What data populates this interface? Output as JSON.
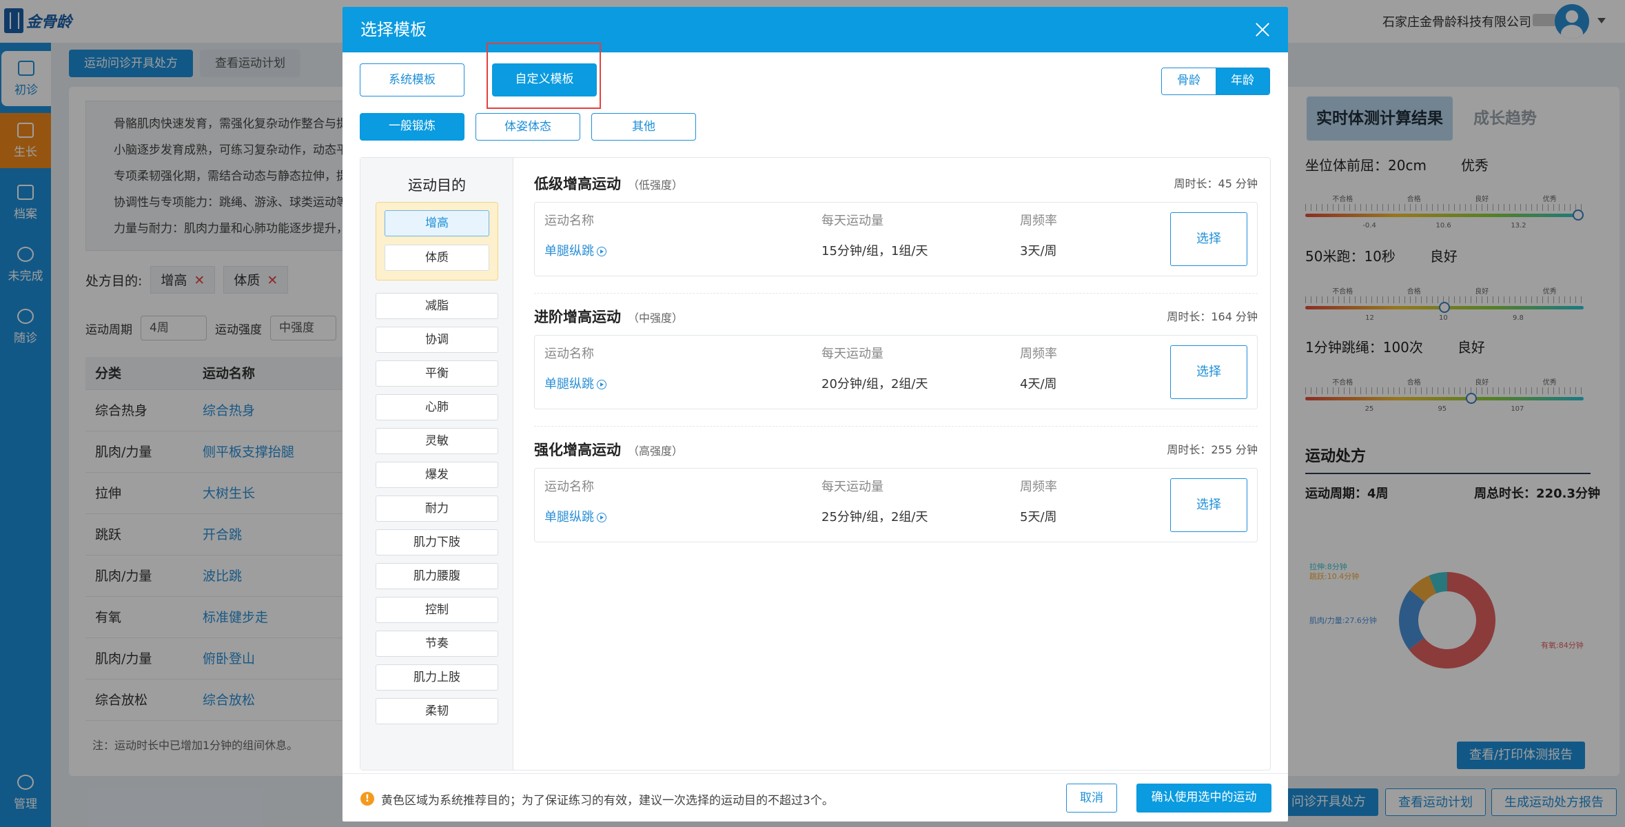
{
  "app": {
    "logo_text": "金骨龄",
    "company": "石家庄金骨龄科技有限公司"
  },
  "sidebar": {
    "items": [
      {
        "label": "初诊",
        "icon": "plus-square-icon"
      },
      {
        "label": "生长",
        "icon": "growth-icon"
      },
      {
        "label": "档案",
        "icon": "archive-icon"
      },
      {
        "label": "未完成",
        "icon": "alert-circle-icon"
      },
      {
        "label": "随诊",
        "icon": "heart-plus-icon"
      },
      {
        "label": "管理",
        "icon": "user-icon"
      }
    ]
  },
  "breadcrumbs": [
    "运动问诊开具处方",
    "查看运动计划"
  ],
  "background": {
    "tips": [
      "骨骼肌肉快速发育，需强化复杂动作整合与提",
      "小脑逐步发育成熟，可练习复杂动作，动态平",
      "专项柔韧强化期，需结合动态与静态拉伸，提",
      "协调性与专项能力：跳绳、游泳、球类运动等",
      "力量与耐力：肌肉力量和心肺功能逐步提升，"
    ],
    "goal_label": "处方目的:",
    "goal_tags": [
      "增高",
      "体质"
    ],
    "period_label": "运动周期",
    "period_value": "4周",
    "intensity_label": "运动强度",
    "intensity_value": "中强度",
    "table": {
      "headers": [
        "分类",
        "运动名称"
      ],
      "rows": [
        [
          "综合热身",
          "综合热身"
        ],
        [
          "肌肉/力量",
          "侧平板支撑抬腿"
        ],
        [
          "拉伸",
          "大树生长"
        ],
        [
          "跳跃",
          "开合跳"
        ],
        [
          "肌肉/力量",
          "波比跳"
        ],
        [
          "有氧",
          "标准健步走"
        ],
        [
          "肌肉/力量",
          "俯卧登山"
        ],
        [
          "综合放松",
          "综合放松"
        ]
      ]
    },
    "note": "注：运动时长中已增加1分钟的组间休息。"
  },
  "right_panel": {
    "tabs": [
      "实时体测计算结果",
      "成长趋势"
    ],
    "metrics": [
      {
        "name": "坐位体前屈：20cm",
        "level": "优秀",
        "grades": [
          "不合格",
          "合格",
          "良好",
          "优秀"
        ],
        "nums": [
          "-0.4",
          "10.6",
          "13.2"
        ],
        "position": 1.0
      },
      {
        "name": "50米跑：10秒",
        "level": "良好",
        "grades": [
          "不合格",
          "合格",
          "良好",
          "优秀"
        ],
        "nums": [
          "12",
          "10",
          "9.8"
        ],
        "position": 0.5
      },
      {
        "name": "1分钟跳绳：100次",
        "level": "良好",
        "grades": [
          "不合格",
          "合格",
          "良好",
          "优秀"
        ],
        "nums": [
          "25",
          "95",
          "107"
        ],
        "position": 0.6
      }
    ],
    "rx_title": "运动处方",
    "rx_period": "运动周期：4周",
    "rx_total": "周总时长：220.3分钟",
    "donut": [
      {
        "label": "有氧:84分钟",
        "value": 84,
        "color": "#e0605e"
      },
      {
        "label": "肌肉/力量:27.6分钟",
        "value": 27.6,
        "color": "#4a90d9"
      },
      {
        "label": "跳跃:10.4分钟",
        "value": 10.4,
        "color": "#f0a93a"
      },
      {
        "label": "拉伸:8分钟",
        "value": 8,
        "color": "#3fc1c9"
      }
    ],
    "print_button": "查看/打印体测报告",
    "bottom_buttons": [
      "问诊开具处方",
      "查看运动计划",
      "生成运动处方报告"
    ]
  },
  "modal": {
    "title": "选择模板",
    "template_buttons": [
      "系统模板",
      "自定义模板"
    ],
    "segment": [
      "骨龄",
      "年龄"
    ],
    "category_tabs": [
      "一般锻炼",
      "体姿体态",
      "其他"
    ],
    "goals_title": "运动目的",
    "recommended_goals": [
      "增高",
      "体质"
    ],
    "other_goals": [
      "减脂",
      "协调",
      "平衡",
      "心肺",
      "灵敏",
      "爆发",
      "耐力",
      "肌力下肢",
      "肌力腰腹",
      "控制",
      "节奏",
      "肌力上肢",
      "柔韧"
    ],
    "plans": [
      {
        "name": "低级增高运动",
        "level": "（低强度）",
        "week": "周时长：45 分钟",
        "col_headers": [
          "运动名称",
          "每天运动量",
          "周频率"
        ],
        "exercise": "单腿纵跳",
        "amount": "15分钟/组，1组/天",
        "freq": "3天/周",
        "select": "选择"
      },
      {
        "name": "进阶增高运动",
        "level": "（中强度）",
        "week": "周时长：164 分钟",
        "col_headers": [
          "运动名称",
          "每天运动量",
          "周频率"
        ],
        "exercise": "单腿纵跳",
        "amount": "20分钟/组，2组/天",
        "freq": "4天/周",
        "select": "选择"
      },
      {
        "name": "强化增高运动",
        "level": "（高强度）",
        "week": "周时长：255 分钟",
        "col_headers": [
          "运动名称",
          "每天运动量",
          "周频率"
        ],
        "exercise": "单腿纵跳",
        "amount": "25分钟/组，2组/天",
        "freq": "5天/周",
        "select": "选择"
      }
    ],
    "footer_note": "黄色区域为系统推荐目的；为了保证练习的有效，建议一次选择的运动目的不超过3个。",
    "cancel": "取消",
    "confirm": "确认使用选中的运动"
  }
}
